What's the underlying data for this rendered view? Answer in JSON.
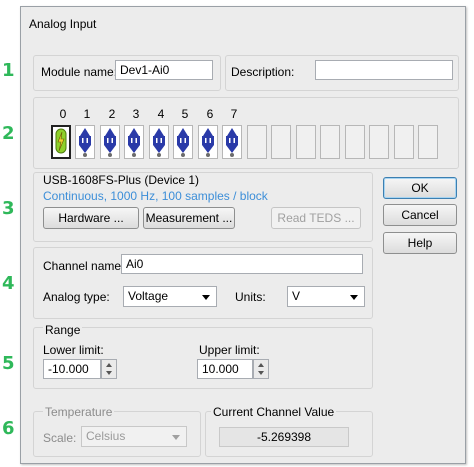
{
  "margin_numbers": [
    "1",
    "2",
    "3",
    "4",
    "5",
    "6"
  ],
  "dialog": {
    "title": "Analog Input"
  },
  "module": {
    "name_label": "Module name:",
    "name_value": "Dev1-Ai0",
    "description_label": "Description:",
    "description_value": ""
  },
  "channels": {
    "numbers": [
      "0",
      "1",
      "2",
      "3",
      "4",
      "5",
      "6",
      "7"
    ],
    "selected_index": 0,
    "active_count": 8,
    "total_slots": 16
  },
  "device": {
    "name": "USB-1608FS-Plus (Device 1)",
    "summary": "Continuous, 1000 Hz, 100 samples / block"
  },
  "buttons": {
    "hardware": "Hardware ...",
    "measurement": "Measurement ...",
    "read_teds": "Read TEDS ...",
    "ok": "OK",
    "cancel": "Cancel",
    "help": "Help"
  },
  "channel_settings": {
    "name_label": "Channel name:",
    "name_value": "Ai0",
    "analog_type_label": "Analog type:",
    "analog_type_value": "Voltage",
    "units_label": "Units:",
    "units_value": "V"
  },
  "range": {
    "title": "Range",
    "lower_label": "Lower limit:",
    "lower_value": "-10.000",
    "upper_label": "Upper limit:",
    "upper_value": "10.000"
  },
  "temperature": {
    "title": "Temperature",
    "scale_label": "Scale:",
    "scale_value": "Celsius"
  },
  "current_value": {
    "title": "Current Channel Value",
    "value": "-5.269398"
  },
  "colors": {
    "green_number": "#2fb85a",
    "link_blue": "#3c8ed8",
    "selected_icon": "#8fd12a",
    "plug_icon": "#2a3aa8"
  }
}
